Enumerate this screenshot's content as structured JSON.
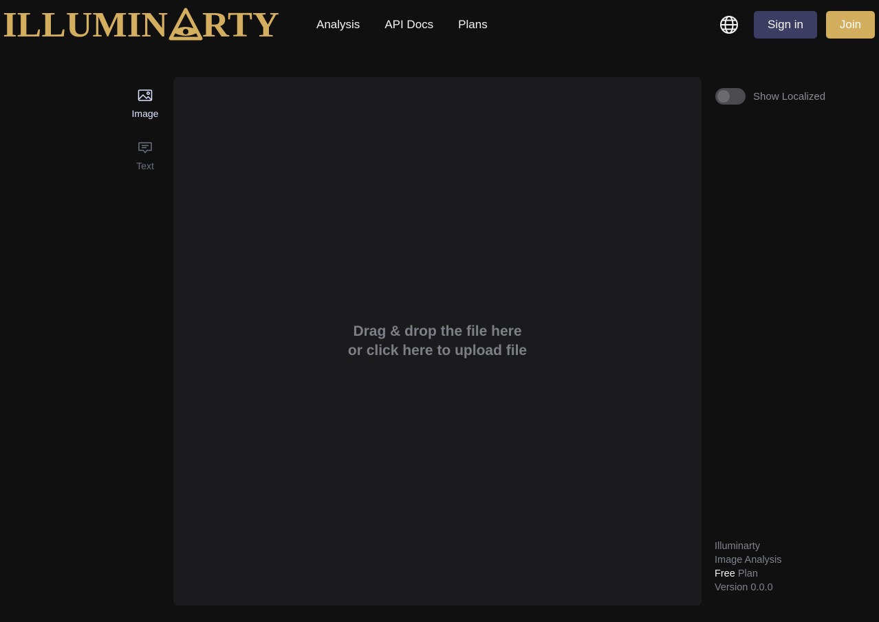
{
  "brand": {
    "name": "ILLUMINARTY",
    "prefix": "ILLUMIN",
    "suffix": "RTY",
    "color": "#d4ae5f"
  },
  "nav": {
    "items": [
      {
        "label": "Analysis"
      },
      {
        "label": "API Docs"
      },
      {
        "label": "Plans"
      }
    ]
  },
  "header": {
    "language_icon": "globe-icon",
    "sign_in_label": "Sign in",
    "join_label": "Join",
    "sign_in_color": "#3d3d63",
    "join_color": "#d4ae5f"
  },
  "sidebar": {
    "tabs": [
      {
        "label": "Image",
        "icon": "image-icon",
        "active": true
      },
      {
        "label": "Text",
        "icon": "message-icon",
        "active": false
      }
    ]
  },
  "dropzone": {
    "line1": "Drag & drop the file here",
    "line2": "or click here to upload file"
  },
  "options": {
    "show_localized_label": "Show Localized",
    "show_localized_on": false
  },
  "info": {
    "app": "Illuminarty",
    "product": "Image Analysis",
    "plan_name": "Free",
    "plan_suffix": "Plan",
    "version": "Version 0.0.0"
  }
}
